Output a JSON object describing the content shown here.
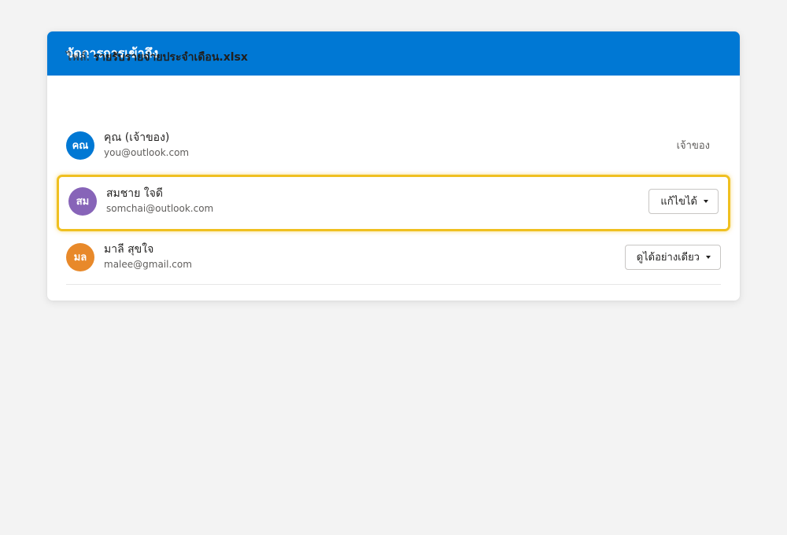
{
  "dialog": {
    "title": "จัดการการเข้าถึง",
    "file_label": "ไฟล์:",
    "file_name": "รายรับรายจ่ายประจำเดือน.xlsx"
  },
  "users": [
    {
      "initials": "คณ",
      "avatar_color": "#0078d4",
      "name": "คุณ (เจ้าของ)",
      "email": "you@outlook.com",
      "role": "เจ้าของ",
      "role_editable": false
    },
    {
      "initials": "สม",
      "avatar_color": "#8764b8",
      "name": "สมชาย ใจดี",
      "email": "somchai@outlook.com",
      "role": "แก้ไขได้",
      "role_editable": true,
      "highlighted": true
    },
    {
      "initials": "มล",
      "avatar_color": "#e8892a",
      "name": "มาลี สุขใจ",
      "email": "malee@gmail.com",
      "role": "ดูได้อย่างเดียว",
      "role_editable": true
    }
  ],
  "colors": {
    "header": "#0078d4",
    "highlight_border": "#f0c020"
  }
}
